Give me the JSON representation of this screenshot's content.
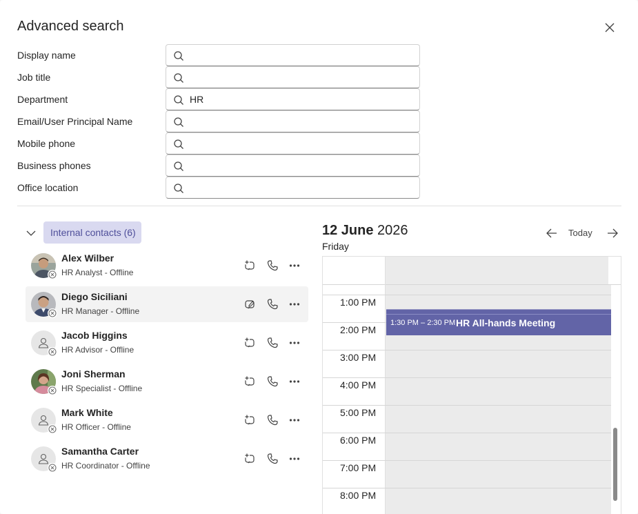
{
  "dialog": {
    "title": "Advanced search"
  },
  "fields": [
    {
      "label": "Display name",
      "value": "",
      "placeholder": ""
    },
    {
      "label": "Job title",
      "value": "",
      "placeholder": ""
    },
    {
      "label": "Department",
      "value": "HR",
      "placeholder": ""
    },
    {
      "label": "Email/User Principal Name",
      "value": "",
      "placeholder": ""
    },
    {
      "label": "Mobile phone",
      "value": "",
      "placeholder": ""
    },
    {
      "label": "Business phones",
      "value": "",
      "placeholder": ""
    },
    {
      "label": "Office location",
      "value": "",
      "placeholder": ""
    }
  ],
  "contacts": {
    "group_label": "Internal contacts (6)",
    "items": [
      {
        "name": "Alex Wilber",
        "subtitle": "HR Analyst - Offline",
        "avatar": "photo",
        "presence": "offline"
      },
      {
        "name": "Diego Siciliani",
        "subtitle": "HR Manager - Offline",
        "avatar": "photo",
        "presence": "offline",
        "selected": true
      },
      {
        "name": "Jacob Higgins",
        "subtitle": "HR Advisor - Offline",
        "avatar": "generic-person-icon",
        "presence": "offline"
      },
      {
        "name": "Joni Sherman",
        "subtitle": "HR Specialist - Offline",
        "avatar": "photo",
        "presence": "offline"
      },
      {
        "name": "Mark White",
        "subtitle": "HR Officer - Offline",
        "avatar": "generic-person-icon",
        "presence": "offline"
      },
      {
        "name": "Samantha Carter",
        "subtitle": "HR Coordinator - Offline",
        "avatar": "generic-person-icon",
        "presence": "offline"
      }
    ]
  },
  "calendar": {
    "date_bold": "12 June",
    "year": "2026",
    "weekday": "Friday",
    "today_label": "Today",
    "hours": [
      "1:00 PM",
      "2:00 PM",
      "3:00 PM",
      "4:00 PM",
      "5:00 PM",
      "6:00 PM",
      "7:00 PM",
      "8:00 PM"
    ],
    "event": {
      "time": "1:30 PM – 2:30 PM",
      "title": "HR All-hands Meeting",
      "color": "#6264a7"
    }
  },
  "colors": {
    "accent": "#6264a7",
    "pill_bg": "#d9d9f0",
    "pill_text": "#4f4f9a"
  }
}
